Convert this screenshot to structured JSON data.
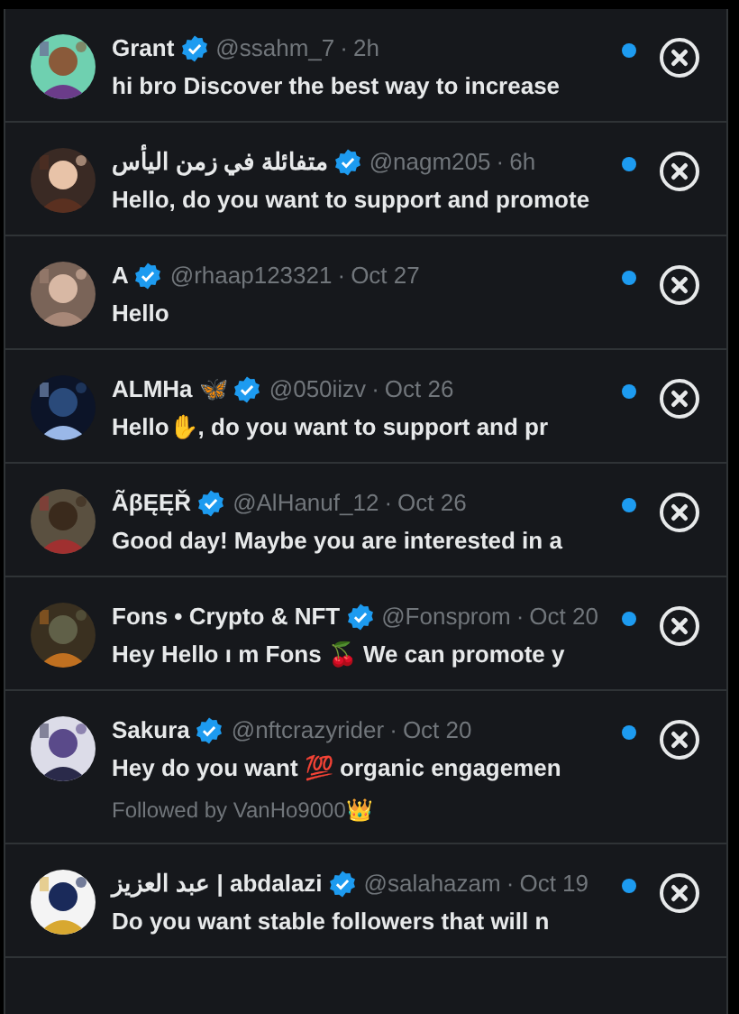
{
  "messages": [
    {
      "name": "Grant",
      "verified": true,
      "handle": "@ssahm_7",
      "separator": "·",
      "time": "2h",
      "text": "hi bro Discover the best way to increase",
      "unread": true
    },
    {
      "name": "متفائلة في زمن اليأس",
      "verified": true,
      "handle": "@nagm205",
      "separator": "·",
      "time": "6h",
      "text": "Hello, do you want to support and promote",
      "unread": true
    },
    {
      "name": "A",
      "verified": true,
      "handle": "@rhaap123321",
      "separator": "·",
      "time": "Oct 27",
      "text": "Hello",
      "unread": true
    },
    {
      "name": "ALMHa 🦋",
      "verified": true,
      "handle": "@050iizv",
      "separator": "·",
      "time": "Oct 26",
      "text": "Hello✋, do you want to support and pr",
      "unread": true
    },
    {
      "name": "ÃβĘĘŘ",
      "verified": true,
      "handle": "@AlHanuf_12",
      "separator": "·",
      "time": "Oct 26",
      "text": "Good day! Maybe you are interested in a",
      "unread": true
    },
    {
      "name": "Fons • Crypto & NFT",
      "verified": true,
      "handle": "@Fonsprom",
      "separator": "·",
      "time": "Oct 20",
      "text": "Hey Hello ı m Fons 🍒 We can promote y",
      "unread": true
    },
    {
      "name": "Sakura",
      "verified": true,
      "handle": "@nftcrazyrider",
      "separator": "·",
      "time": "Oct 20",
      "text": "Hey do you want 💯 organic engagemen",
      "followed_by": "Followed by VanHo9000👑",
      "unread": true
    },
    {
      "name": "عبد العزيز | abdalazi",
      "verified": true,
      "handle": "@salahazam",
      "separator": "·",
      "time": "Oct 19",
      "text": "Do you want stable followers that will n",
      "unread": true
    }
  ]
}
